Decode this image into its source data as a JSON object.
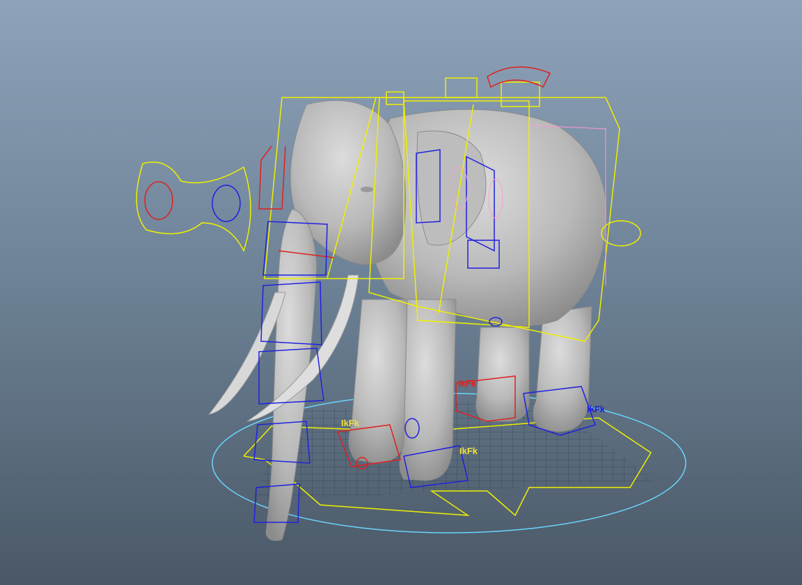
{
  "viewport": {
    "background_top": "#8ea3b9",
    "background_bottom": "#4a5866"
  },
  "scene": {
    "model": "elephant",
    "mesh_color": "#c8c8c8",
    "control_colors": {
      "main_controls": "#f0f000",
      "fk_controls": "#2020e0",
      "ik_controls": "#e02020",
      "world_circle": "#6ad6ff",
      "accent": "#ff9ad0"
    }
  },
  "labels": {
    "ikfk_front_left": "IkFk",
    "ikfk_front_right": "IkFk",
    "ikfk_rear_left": "IkFk",
    "ikfk_rear_right": "IkFk"
  }
}
